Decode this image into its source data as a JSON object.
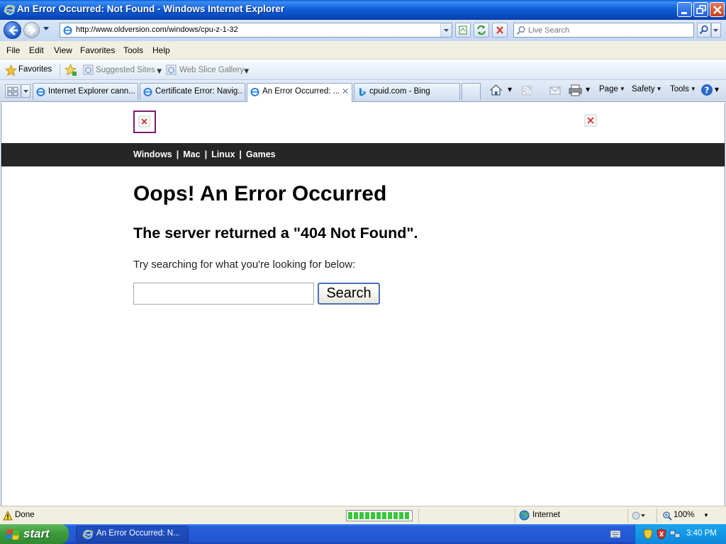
{
  "window": {
    "title": "An Error Occurred: Not Found - Windows Internet Explorer"
  },
  "addressbar": {
    "url": "http://www.oldversion.com/windows/cpu-z-1-32",
    "search_placeholder": "Live Search"
  },
  "menu": [
    "File",
    "Edit",
    "View",
    "Favorites",
    "Tools",
    "Help"
  ],
  "favorites_bar": {
    "favorites_label": "Favorites",
    "suggested_sites": "Suggested Sites",
    "web_slice_gallery": "Web Slice Gallery"
  },
  "tabs": [
    {
      "label": "Internet Explorer cann...",
      "icon": "ie-icon",
      "active": false
    },
    {
      "label": "Certificate Error: Navig...",
      "icon": "ie-icon",
      "active": false
    },
    {
      "label": "An Error Occurred: ...",
      "icon": "ie-icon",
      "active": true
    },
    {
      "label": "cpuid.com - Bing",
      "icon": "bing-icon",
      "active": false
    }
  ],
  "command_bar": {
    "page": "Page",
    "safety": "Safety",
    "tools": "Tools"
  },
  "page": {
    "nav_links": [
      "Windows",
      "Mac",
      "Linux",
      "Games"
    ],
    "nav_separator": "|",
    "heading": "Oops! An Error Occurred",
    "subheading": "The server returned a \"404 Not Found\".",
    "hint": "Try searching for what you're looking for below:",
    "search_value": "",
    "search_button": "Search"
  },
  "statusbar": {
    "status": "Done",
    "progress_percent": 100,
    "zone": "Internet",
    "zoom": "100%"
  },
  "taskbar": {
    "start_label": "start",
    "task_item": "An Error Occurred: N...",
    "clock": "3:40 PM"
  },
  "colors": {
    "titlebar": "#0845b8",
    "site_nav": "#262626",
    "start_button": "#3c9b3c",
    "taskbar": "#245edb"
  }
}
